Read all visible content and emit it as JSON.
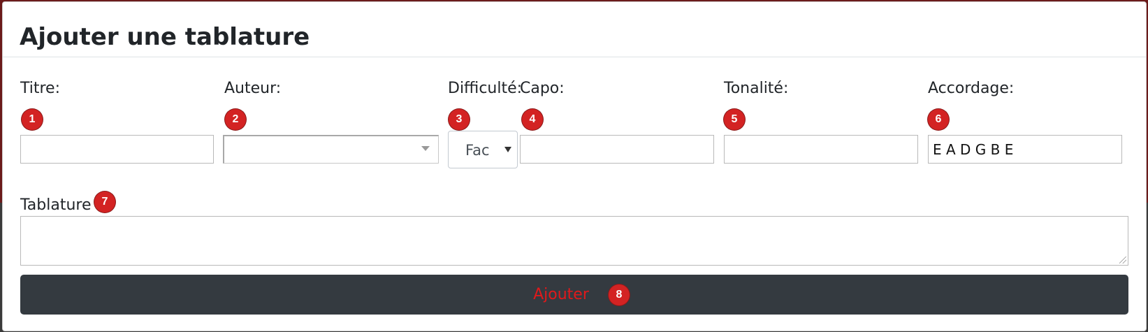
{
  "modal": {
    "title": "Ajouter une tablature"
  },
  "fields": {
    "titre": {
      "label": "Titre:",
      "value": ""
    },
    "auteur": {
      "label": "Auteur:",
      "value": ""
    },
    "difficulte": {
      "label": "Difficulté:",
      "selected": "Fac"
    },
    "capo": {
      "label": "Capo:",
      "value": ""
    },
    "tonalite": {
      "label": "Tonalité:",
      "value": ""
    },
    "accordage": {
      "label": "Accordage:",
      "value": "E A D G B E"
    }
  },
  "tablature": {
    "label": "Tablature",
    "value": ""
  },
  "submit": {
    "label": "Ajouter"
  },
  "badges": [
    "1",
    "2",
    "3",
    "4",
    "5",
    "6",
    "7",
    "8"
  ],
  "colors": {
    "badge": "#d32323",
    "button_bg": "#343a40",
    "button_text": "#e0191b"
  }
}
